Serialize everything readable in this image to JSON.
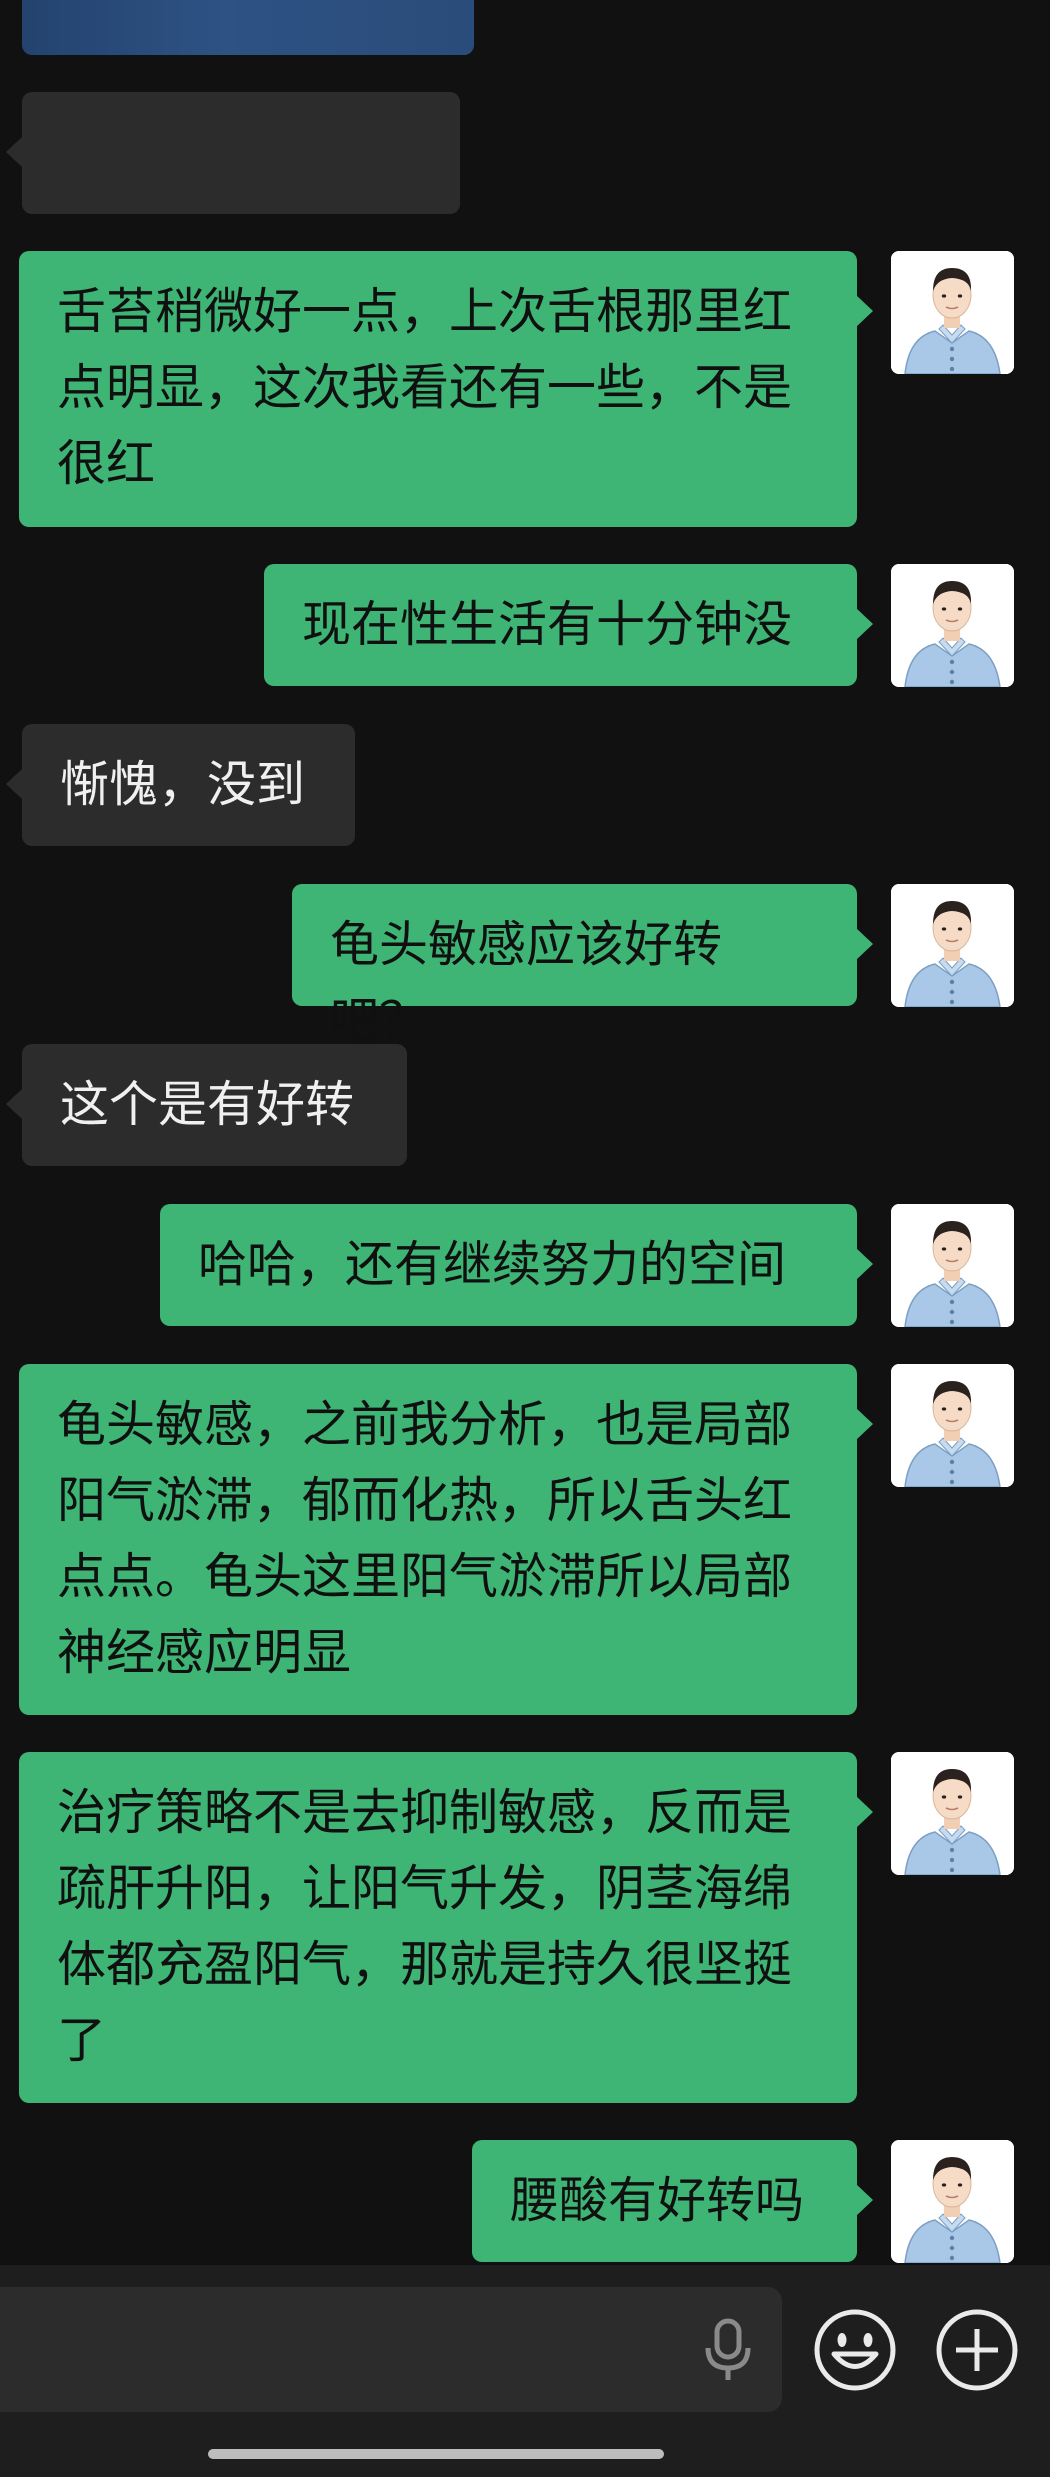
{
  "messages": [
    {
      "direction": "in",
      "text": ""
    },
    {
      "direction": "out",
      "text": "舌苔稍微好一点，上次舌根那里红点明显，这次我看还有一些，不是很红"
    },
    {
      "direction": "out",
      "text": "现在性生活有十分钟没"
    },
    {
      "direction": "in",
      "text": "惭愧，没到"
    },
    {
      "direction": "out",
      "text": "龟头敏感应该好转吧？"
    },
    {
      "direction": "in",
      "text": "这个是有好转"
    },
    {
      "direction": "out",
      "text": "哈哈，还有继续努力的空间"
    },
    {
      "direction": "out",
      "text": "龟头敏感，之前我分析，也是局部阳气淤滞，郁而化热，所以舌头红点点。龟头这里阳气淤滞所以局部神经感应明显"
    },
    {
      "direction": "out",
      "text": "治疗策略不是去抑制敏感，反而是疏肝升阳，让阳气升发，阴茎海绵体都充盈阳气，那就是持久很坚挺了"
    },
    {
      "direction": "out",
      "text": "腰酸有好转吗"
    }
  ],
  "input": {
    "value": "",
    "mic_icon": "microphone-icon",
    "emoji_icon": "smiley-face-icon",
    "plus_icon": "plus-circle-icon"
  },
  "colors": {
    "background": "#111111",
    "outgoing_bubble": "#3eb575",
    "incoming_bubble": "#2c2c2c"
  }
}
